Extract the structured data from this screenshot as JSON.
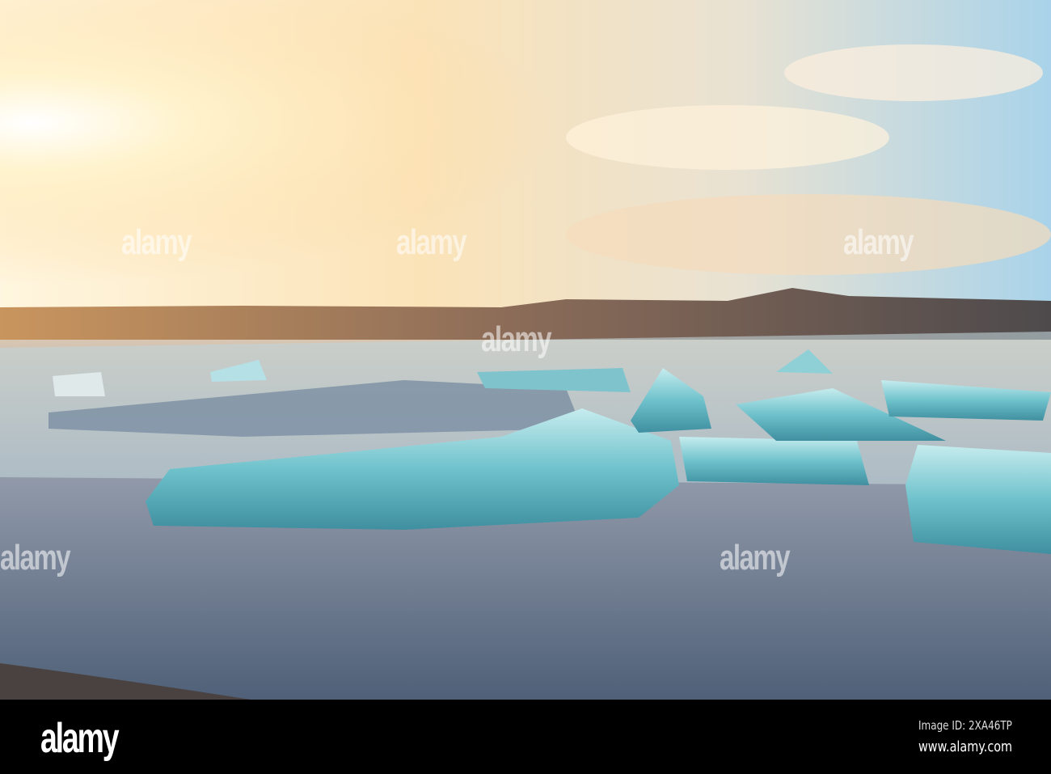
{
  "watermark": {
    "text": "alamy"
  },
  "footer": {
    "logo": "alamy",
    "image_id": "Image ID: 2XA46TP",
    "url": "www.alamy.com"
  }
}
